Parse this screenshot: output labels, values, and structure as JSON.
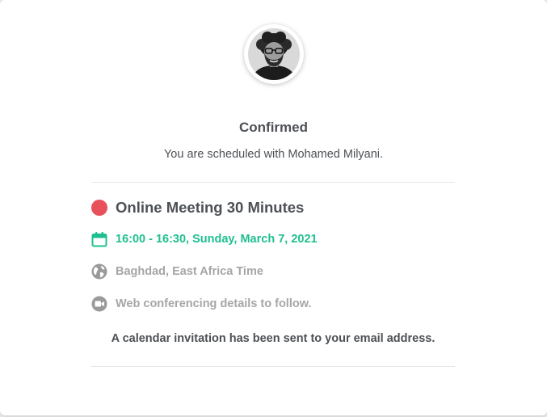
{
  "host": {
    "name": "Mohamed Milyani"
  },
  "confirmation": {
    "title": "Confirmed",
    "subtitle": "You are scheduled with Mohamed Milyani."
  },
  "event": {
    "name": "Online Meeting 30 Minutes",
    "color": "#e8505b",
    "datetime": "16:00 - 16:30, Sunday, March 7, 2021",
    "timezone": "Baghdad, East Africa Time",
    "location": "Web conferencing details to follow."
  },
  "notice": "A calendar invitation has been sent to your email address.",
  "icons": {
    "event_dot": "red-circle",
    "datetime": "calendar-icon",
    "timezone": "globe-icon",
    "location": "video-camera-icon"
  },
  "colors": {
    "accent": "#1fbf8f",
    "text": "#4d5055",
    "muted": "#a6a6a6"
  }
}
